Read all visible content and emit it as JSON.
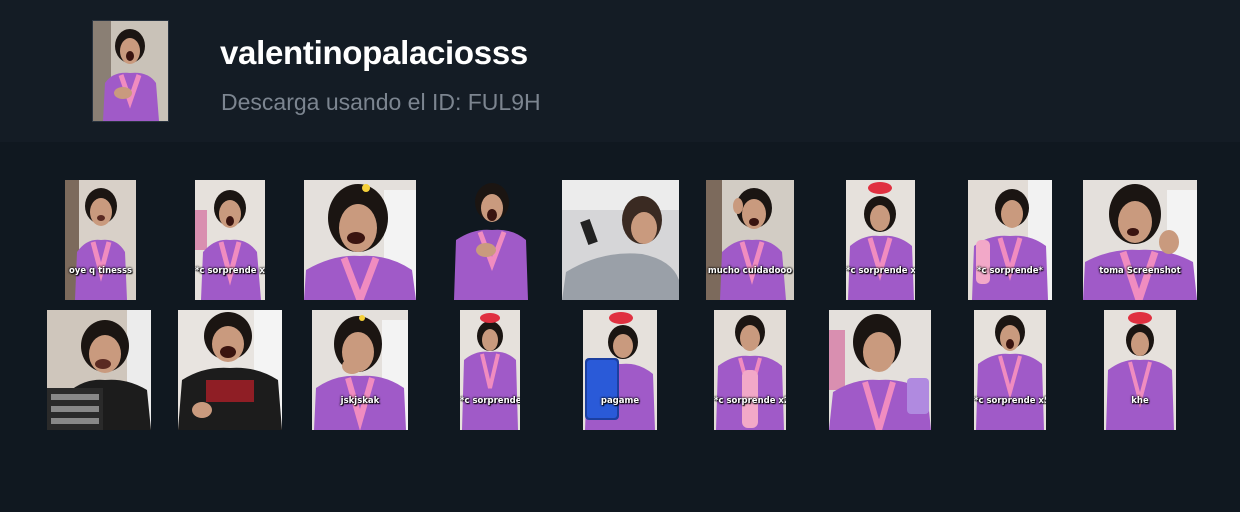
{
  "profile": {
    "username": "valentinopalaciosss",
    "id_prompt": "Descarga usando el ID: FUL9H"
  },
  "stickers": [
    {
      "caption": "oye q tinesss"
    },
    {
      "caption": "*c sorprende x3*"
    },
    {
      "caption": ""
    },
    {
      "caption": ""
    },
    {
      "caption": ""
    },
    {
      "caption": "mucho cuidadooo"
    },
    {
      "caption": "*c sorprende x4*"
    },
    {
      "caption": "*c sorprende*"
    },
    {
      "caption": "toma Screenshot"
    },
    {
      "caption": ""
    },
    {
      "caption": ""
    },
    {
      "caption": "jskjskak"
    },
    {
      "caption": "*c sorprende x7*"
    },
    {
      "caption": "pagame"
    },
    {
      "caption": "*c sorprende x2*"
    },
    {
      "caption": ""
    },
    {
      "caption": "*c sorprende x5*"
    },
    {
      "caption": "khe"
    }
  ],
  "colors": {
    "page_bg": "#101820",
    "header_bg": "#141c25",
    "robe": "#a05ac8",
    "robe_trim": "#f08cc0"
  }
}
